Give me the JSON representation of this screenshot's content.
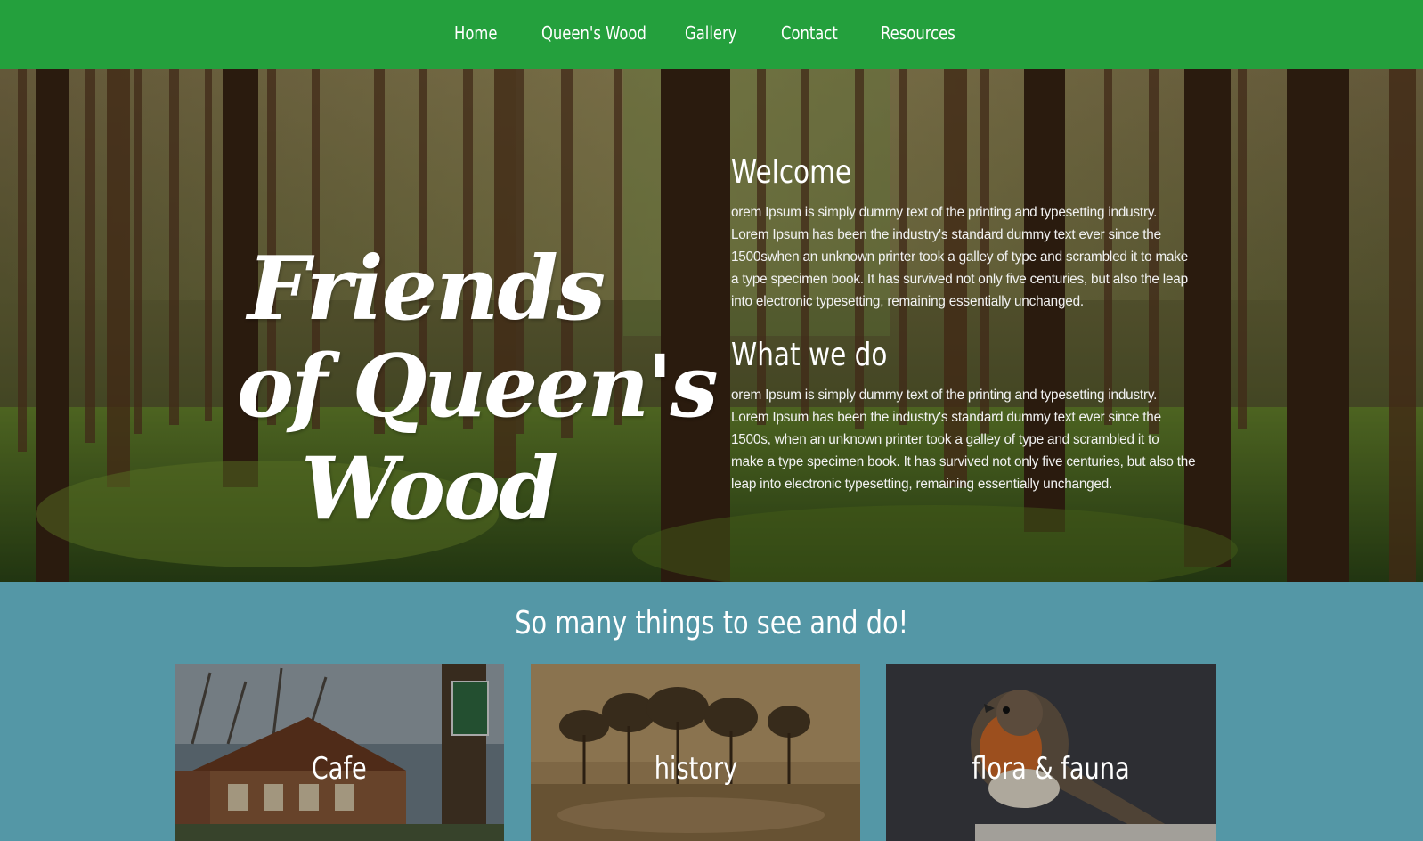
{
  "nav": {
    "items": [
      {
        "label": "Home"
      },
      {
        "label": "Queen's Wood"
      },
      {
        "label": "Gallery"
      },
      {
        "label": "Contact"
      },
      {
        "label": "Resources"
      }
    ]
  },
  "hero": {
    "logo": {
      "line1": "Friends",
      "line2": "of Queen's",
      "line3": "Wood"
    },
    "welcome": {
      "heading": "Welcome",
      "lines": [
        "orem Ipsum is simply dummy text of the printing and typesetting industry.",
        "Lorem Ipsum has been the industry's standard dummy text ever since the",
        "1500swhen an unknown printer took a galley of type and scrambled it to make",
        "a type specimen book. It has survived not only five centuries, but also the leap",
        "into electronic typesetting, remaining essentially unchanged."
      ]
    },
    "what_we_do": {
      "heading": "What we do",
      "lines": [
        "orem Ipsum is simply dummy text of the printing and typesetting industry.",
        "Lorem Ipsum has been the industry's standard dummy text ever since the",
        "1500s, when an unknown printer took a galley of type and scrambled it to",
        "make a type specimen book. It has survived not only five centuries, but also the",
        "leap into electronic typesetting, remaining essentially unchanged."
      ]
    }
  },
  "section": {
    "title": "So many things to see and do!",
    "cards": [
      {
        "label": "Cafe"
      },
      {
        "label": "history"
      },
      {
        "label": "flora & fauna"
      }
    ]
  },
  "colors": {
    "nav_bg": "#24a03d",
    "section_bg": "#5497a6",
    "text": "#ffffff"
  }
}
